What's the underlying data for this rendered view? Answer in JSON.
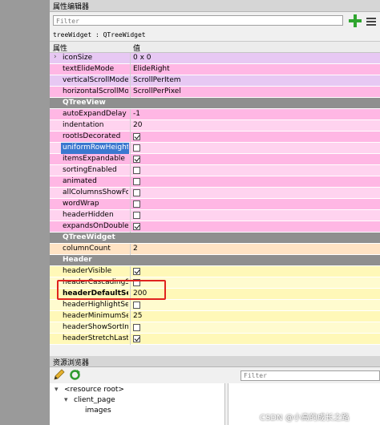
{
  "property_editor": {
    "title": "属性编辑器",
    "filter_placeholder": "Filter",
    "object_line": "treeWidget : QTreeWidget",
    "columns": {
      "property": "属性",
      "value": "值"
    }
  },
  "rows": [
    {
      "name": "iconSize",
      "value": "0 x 0",
      "expand": true
    },
    {
      "name": "textElideMode",
      "value": "ElideRight"
    },
    {
      "name": "verticalScrollMode",
      "value": "ScrollPerItem"
    },
    {
      "name": "horizontalScrollMo...",
      "value": "ScrollPerPixel"
    },
    {
      "category": "QTreeView"
    },
    {
      "name": "autoExpandDelay",
      "value": "-1"
    },
    {
      "name": "indentation",
      "value": "20"
    },
    {
      "name": "rootIsDecorated",
      "check": true
    },
    {
      "name": "uniformRowHeights",
      "check": false,
      "selected": true
    },
    {
      "name": "itemsExpandable",
      "check": true
    },
    {
      "name": "sortingEnabled",
      "check": false
    },
    {
      "name": "animated",
      "check": false
    },
    {
      "name": "allColumnsShowFo...",
      "check": false
    },
    {
      "name": "wordWrap",
      "check": false
    },
    {
      "name": "headerHidden",
      "check": false
    },
    {
      "name": "expandsOnDouble...",
      "check": true
    },
    {
      "category": "QTreeWidget"
    },
    {
      "name": "columnCount",
      "value": "2"
    },
    {
      "category": "Header"
    },
    {
      "name": "headerVisible",
      "check": true
    },
    {
      "name": "headerCascadingS...",
      "check": false
    },
    {
      "name": "headerDefaultSec...",
      "value": "200",
      "bold": true
    },
    {
      "name": "headerHighlightSec...",
      "check": false
    },
    {
      "name": "headerMinimumSe...",
      "value": "25"
    },
    {
      "name": "headerShowSortIn...",
      "check": false
    },
    {
      "name": "headerStretchLastS...",
      "check": true
    }
  ],
  "colors": {
    "lilac": "#e7c8f3",
    "pink": "#ffb7e4",
    "pink_light": "#ffd3ef",
    "peach": "#ffe3c4",
    "yellow": "#fff8b8",
    "yellow_light": "#fffbcf",
    "category": "#8f8f8f"
  },
  "resource_browser": {
    "title": "资源浏览器",
    "filter_placeholder": "Filter",
    "tree": [
      "<resource root>",
      "client_page",
      "images"
    ],
    "pencil_icon": "pencil-icon",
    "reload_icon": "reload-icon"
  },
  "watermark": "CSDN @小高的成长之路"
}
